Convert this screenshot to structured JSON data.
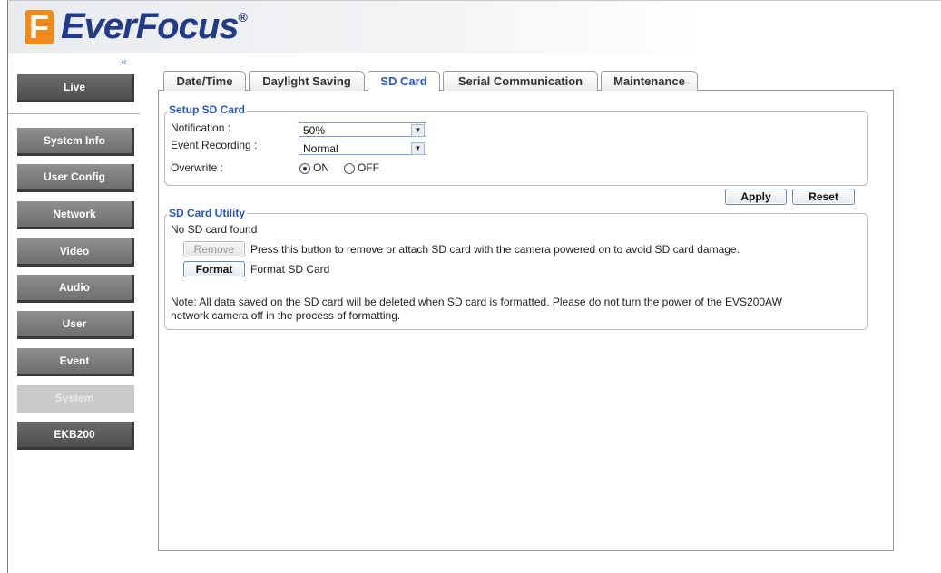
{
  "brand": {
    "name": "EverFocus",
    "registered": "®"
  },
  "sidebar": {
    "collapse_glyph": "«",
    "items": [
      {
        "label": "Live"
      },
      {
        "label": "System Info"
      },
      {
        "label": "User Config"
      },
      {
        "label": "Network"
      },
      {
        "label": "Video"
      },
      {
        "label": "Audio"
      },
      {
        "label": "User"
      },
      {
        "label": "Event"
      },
      {
        "label": "System",
        "active": true
      },
      {
        "label": "EKB200"
      }
    ]
  },
  "tabs": [
    {
      "label": "Date/Time"
    },
    {
      "label": "Daylight Saving"
    },
    {
      "label": "SD Card",
      "active": true
    },
    {
      "label": "Serial Communication"
    },
    {
      "label": "Maintenance"
    }
  ],
  "setup": {
    "legend": "Setup SD Card",
    "notification_label": "Notification :",
    "notification_value": "50%",
    "event_recording_label": "Event Recording :",
    "event_recording_value": "Normal",
    "overwrite_label": "Overwrite :",
    "overwrite_on": "ON",
    "overwrite_off": "OFF",
    "overwrite_selected": "ON"
  },
  "actions": {
    "apply": "Apply",
    "reset": "Reset"
  },
  "utility": {
    "legend": "SD Card Utility",
    "status": "No SD card found",
    "remove_button": "Remove",
    "remove_desc": "Press this button to remove or attach SD card with the camera powered on to avoid SD card damage.",
    "format_button": "Format",
    "format_desc": "Format SD Card",
    "note_line1": "Note: All data saved on the SD card will be deleted when SD card is formatted. Please do not turn the power of the EVS200AW",
    "note_line2": "network camera off in the process of formatting."
  },
  "colors": {
    "accent": "#2b57b8",
    "logo_orange": "#f08a1c",
    "logo_blue": "#223a8c"
  }
}
